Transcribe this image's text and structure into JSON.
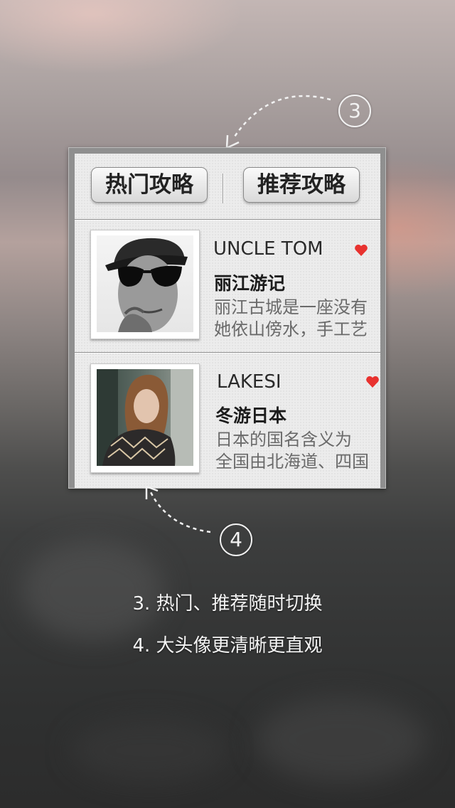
{
  "tabs": {
    "hot_label": "热门攻略",
    "recommend_label": "推荐攻略"
  },
  "guides": [
    {
      "author": "UNCLE TOM",
      "title": "丽江游记",
      "desc_line1": "丽江古城是一座没有",
      "desc_line2": "她依山傍水，手工艺"
    },
    {
      "author": "LAKESI",
      "title": "冬游日本",
      "desc_line1": "日本的国名含义为",
      "desc_line2": "全国由北海道、四国"
    }
  ],
  "annotations": {
    "step3_number": "3",
    "step4_number": "4"
  },
  "captions": {
    "line1": "3. 热门、推荐随时切换",
    "line2": "4. 大头像更清晰更直观"
  },
  "colors": {
    "heart": "#e8322f",
    "caption_text": "#f4f4f4"
  }
}
